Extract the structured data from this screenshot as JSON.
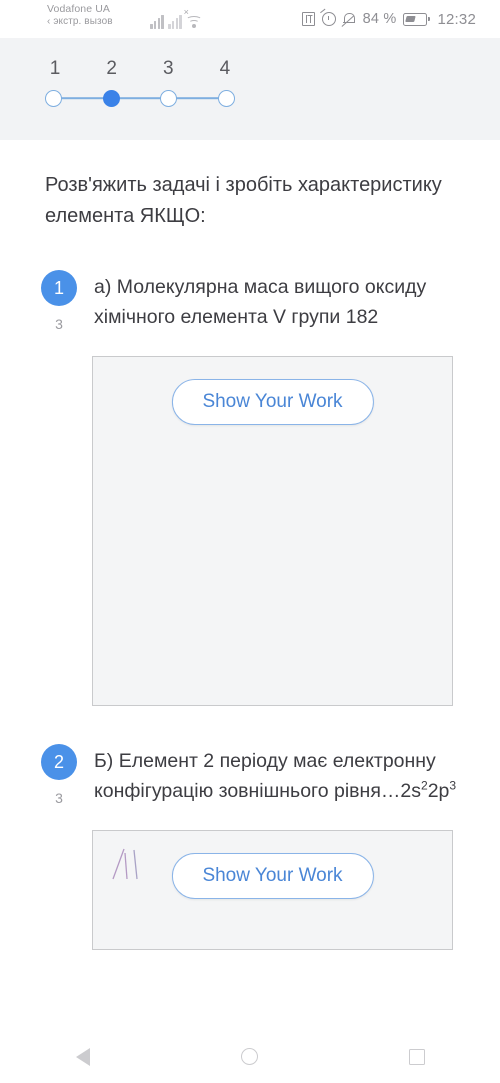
{
  "status_bar": {
    "carrier": "Vodafone UA",
    "carrier_sub": "экстр. вызов",
    "battery_percent": "84 %",
    "clock": "12:32",
    "icons": [
      "signal-bars-icon",
      "signal-bars-sim2-icon",
      "wifi-icon",
      "nfc-icon",
      "alarm-icon",
      "bell-muted-icon",
      "battery-icon"
    ]
  },
  "stepper": {
    "steps": [
      {
        "label": "1",
        "active": false
      },
      {
        "label": "2",
        "active": true
      },
      {
        "label": "3",
        "active": false
      },
      {
        "label": "4",
        "active": false
      }
    ],
    "active_color": "#3b82e8",
    "track_color": "#7eaee0"
  },
  "main": {
    "prompt": "Розв'яжить задачі і зробіть характеристику елемента ЯКЩО:",
    "questions": [
      {
        "number": "1",
        "points": "3",
        "text_parts": [
          {
            "t": "а) Молекулярна маса вищого оксиду хімічного елемента V групи 182",
            "sup": ""
          }
        ],
        "answer_button": "Show Your Work",
        "has_ink": false
      },
      {
        "number": "2",
        "points": "3",
        "text_parts": [
          {
            "t": "Б) Елемент 2 періоду має електронну конфігурацію зовнішнього рівня…2s",
            "sup": "2"
          },
          {
            "t": "2p",
            "sup": "3"
          }
        ],
        "answer_button": "Show Your Work",
        "has_ink": true
      }
    ]
  },
  "navbar": {
    "back": "back-icon",
    "home": "home-icon",
    "recents": "recents-icon"
  },
  "colors": {
    "accent_blue": "#4a91e8",
    "band_bg": "#f2f3f5",
    "answer_bg": "#f4f5f6",
    "text": "#3d3d42"
  }
}
